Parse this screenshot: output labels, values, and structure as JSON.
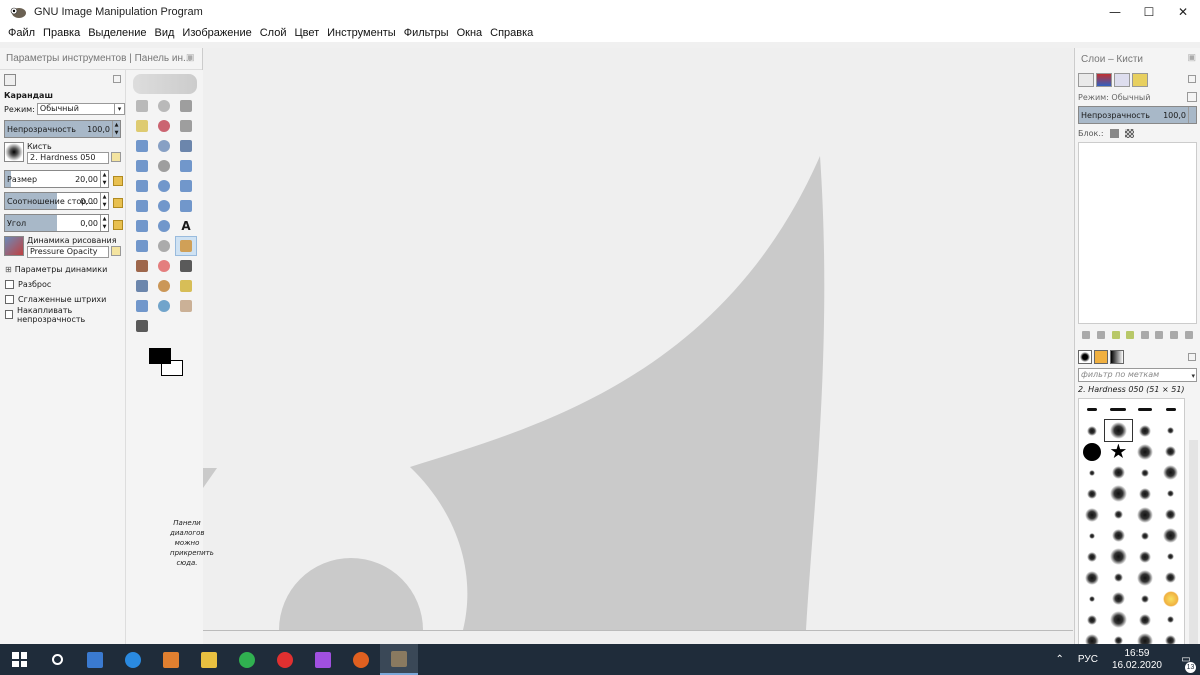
{
  "window": {
    "title": "GNU Image Manipulation Program",
    "controls": {
      "minimize": "—",
      "maximize": "☐",
      "close": "✕"
    }
  },
  "menu": [
    "Файл",
    "Правка",
    "Выделение",
    "Вид",
    "Изображение",
    "Слой",
    "Цвет",
    "Инструменты",
    "Фильтры",
    "Окна",
    "Справка"
  ],
  "left_dock": {
    "tab_header": "Параметры инструментов | Панель ин...",
    "tool_name": "Карандаш",
    "mode_label": "Режим:",
    "mode_value": "Обычный",
    "opacity": {
      "label": "Непрозрачность",
      "value": "100,0",
      "fraction": 1.0
    },
    "brush_label": "Кисть",
    "brush_name": "2. Hardness 050",
    "size": {
      "label": "Размер",
      "value": "20,00",
      "fraction": 0.06
    },
    "ratio": {
      "label": "Соотношение стор...",
      "value": "0,00",
      "fraction": 0.5
    },
    "angle": {
      "label": "Угол",
      "value": "0,00",
      "fraction": 0.5
    },
    "dynamics_label": "Динамика рисования",
    "dynamics_name": "Pressure Opacity",
    "dynamics_options": "Параметры динамики",
    "checkboxes": [
      "Разброс",
      "Сглаженные штрихи",
      "Накапливать непрозрачность"
    ],
    "dock_hint": "Панели диалогов можно прикрепить сюда."
  },
  "toolbox": {
    "tools": [
      "rect-select-icon",
      "ellipse-select-icon",
      "free-select-icon",
      "fuzzy-select-icon",
      "color-select-icon",
      "scissors-icon",
      "foreground-select-icon",
      "paths-icon",
      "color-picker-icon",
      "zoom-icon",
      "measure-icon",
      "move-icon",
      "align-icon",
      "transform-icon",
      "unified-transform-icon",
      "crop-icon",
      "perspective-icon",
      "warp-icon",
      "flip-icon",
      "cage-icon",
      "text-icon",
      "bucket-fill-icon",
      "gradient-icon",
      "pencil-icon",
      "paintbrush-icon",
      "eraser-icon",
      "airbrush-icon",
      "ink-icon",
      "clone-icon",
      "heal-icon",
      "perspective-clone-icon",
      "blur-icon",
      "smudge-icon",
      "dodge-burn-icon"
    ],
    "active_tool": "pencil-icon",
    "fg_color": "#000000",
    "bg_color": "#ffffff"
  },
  "right_dock": {
    "tab_header": "Слои – Кисти",
    "mode": "Режим: Обычный",
    "opacity": {
      "label": "Непрозрачность",
      "value": "100,0"
    },
    "lock_label": "Блок.:",
    "brush_filter_placeholder": "фильтр по меткам",
    "selected_brush": "2. Hardness 050 (51 × 51)"
  },
  "taskbar": {
    "apps": [
      "start-icon",
      "search-icon",
      "store-icon",
      "edge-icon",
      "media-player-icon",
      "file-explorer-icon",
      "mail-icon",
      "yandex-browser-icon",
      "app-icon",
      "firefox-icon",
      "gimp-icon"
    ],
    "active_app": "gimp-icon",
    "language": "РУС",
    "time": "16:59",
    "date": "16.02.2020",
    "notifications": "13"
  },
  "colors": {
    "accent": "#7aa7d8",
    "taskbar": "#1f2c3a",
    "canvas_shape": "#cacaca"
  }
}
